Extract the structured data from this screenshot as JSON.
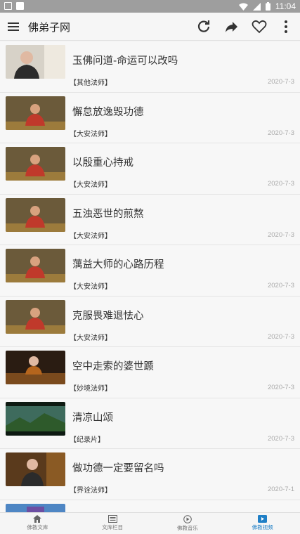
{
  "statusbar": {
    "time": "11:04"
  },
  "appbar": {
    "title": "佛弟子网"
  },
  "items": [
    {
      "title": "玉佛问道-命运可以改吗",
      "category": "【其他法师】",
      "date": "2020-7-3"
    },
    {
      "title": "懈怠放逸毁功德",
      "category": "【大安法师】",
      "date": "2020-7-3"
    },
    {
      "title": "以殷重心持戒",
      "category": "【大安法师】",
      "date": "2020-7-3"
    },
    {
      "title": "五浊恶世的煎熬",
      "category": "【大安法师】",
      "date": "2020-7-3"
    },
    {
      "title": "蕅益大师的心路历程",
      "category": "【大安法师】",
      "date": "2020-7-3"
    },
    {
      "title": "克服畏难退怯心",
      "category": "【大安法师】",
      "date": "2020-7-3"
    },
    {
      "title": "空中走索的婆世踬",
      "category": "【妙境法师】",
      "date": "2020-7-3"
    },
    {
      "title": "清凉山颂",
      "category": "【纪录片】",
      "date": "2020-7-3"
    },
    {
      "title": "做功德一定要留名吗",
      "category": "【界诠法师】",
      "date": "2020-7-1"
    }
  ],
  "tabs": [
    {
      "label": "佛教文库",
      "icon": "home-icon"
    },
    {
      "label": "文库栏目",
      "icon": "list-icon"
    },
    {
      "label": "佛教音乐",
      "icon": "music-icon"
    },
    {
      "label": "佛教视频",
      "icon": "video-icon"
    }
  ],
  "colors": {
    "accent": "#1f7fc6",
    "statusbar": "#9e9e9e"
  }
}
